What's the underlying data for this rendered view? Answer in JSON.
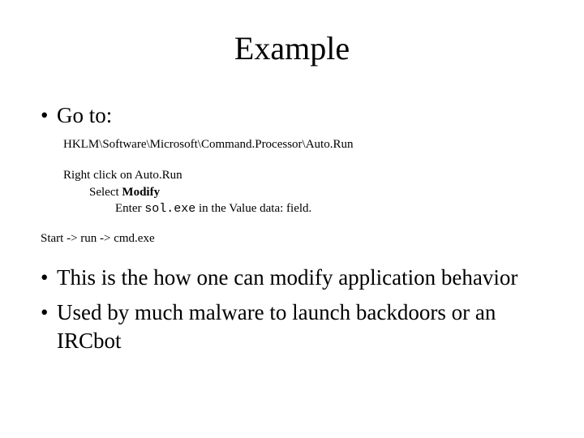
{
  "title": "Example",
  "bullets": {
    "goto": "Go to:",
    "modify": "This is the how one can modify application behavior",
    "malware": "Used by much malware to launch backdoors or an IRCbot"
  },
  "registry_path": "HKLM\\Software\\Microsoft\\Command.Processor\\Auto.Run",
  "steps": {
    "s1": "Right click on Auto.Run",
    "s2_prefix": "Select ",
    "s2_bold": "Modify",
    "s3_prefix": "Enter ",
    "s3_code": "sol.exe",
    "s3_suffix": " in the Value data: field."
  },
  "start_line": "Start -> run  -> cmd.exe"
}
